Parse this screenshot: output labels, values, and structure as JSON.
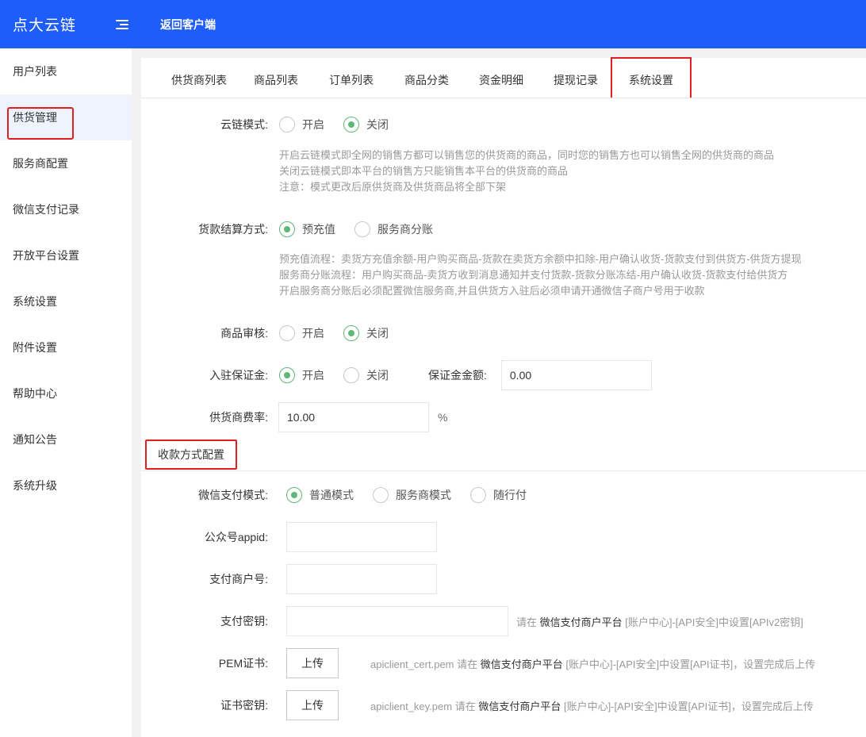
{
  "header": {
    "logo": "点大云链",
    "back_link": "返回客户端"
  },
  "sidebar": {
    "items": [
      {
        "label": "用户列表"
      },
      {
        "label": "供货管理"
      },
      {
        "label": "服务商配置"
      },
      {
        "label": "微信支付记录"
      },
      {
        "label": "开放平台设置"
      },
      {
        "label": "系统设置"
      },
      {
        "label": "附件设置"
      },
      {
        "label": "帮助中心"
      },
      {
        "label": "通知公告"
      },
      {
        "label": "系统升级"
      }
    ],
    "active": "供货管理"
  },
  "tabs": [
    {
      "label": "供货商列表"
    },
    {
      "label": "商品列表"
    },
    {
      "label": "订单列表"
    },
    {
      "label": "商品分类"
    },
    {
      "label": "资金明细"
    },
    {
      "label": "提现记录"
    },
    {
      "label": "系统设置"
    }
  ],
  "active_tab": "系统设置",
  "form": {
    "cloud_mode": {
      "label": "云链模式:",
      "options": [
        "开启",
        "关闭"
      ],
      "selected": "关闭",
      "help": [
        "开启云链模式即全网的销售方都可以销售您的供货商的商品，同时您的销售方也可以销售全网的供货商的商品",
        "关闭云链模式即本平台的销售方只能销售本平台的供货商的商品",
        "注意：模式更改后原供货商及供货商品将全部下架"
      ]
    },
    "settlement": {
      "label": "货款结算方式:",
      "options": [
        "预充值",
        "服务商分账"
      ],
      "selected": "预充值",
      "help": [
        "预充值流程：卖货方充值余额-用户购买商品-货款在卖货方余额中扣除-用户确认收货-货款支付到供货方-供货方提现",
        "服务商分账流程：用户购买商品-卖货方收到消息通知并支付货款-货款分账冻结-用户确认收货-货款支付给供货方",
        "开启服务商分账后必须配置微信服务商,并且供货方入驻后必须申请开通微信子商户号用于收款"
      ]
    },
    "goods_review": {
      "label": "商品审核:",
      "options": [
        "开启",
        "关闭"
      ],
      "selected": "关闭"
    },
    "deposit": {
      "label": "入驻保证金:",
      "options": [
        "开启",
        "关闭"
      ],
      "selected": "开启",
      "amount_label": "保证金金额:",
      "amount_value": "0.00"
    },
    "fee_rate": {
      "label": "供货商费率:",
      "value": "10.00",
      "unit": "%"
    }
  },
  "payment_section": {
    "title": "收款方式配置",
    "wechat_mode": {
      "label": "微信支付模式:",
      "options": [
        "普通模式",
        "服务商模式",
        "随行付"
      ],
      "selected": "普通模式"
    },
    "appid": {
      "label": "公众号appid:",
      "value": ""
    },
    "merchant_id": {
      "label": "支付商户号:",
      "value": ""
    },
    "pay_key": {
      "label": "支付密钥:",
      "value": "",
      "tip_prefix": "请在 ",
      "tip_platform": "微信支付商户平台",
      "tip_suffix": " [账户中心]-[API安全]中设置[APIv2密钥]"
    },
    "pem_cert": {
      "label": "PEM证书:",
      "button": "上传",
      "tip_prefix": "apiclient_cert.pem 请在 ",
      "tip_platform": "微信支付商户平台",
      "tip_suffix": " [账户中心]-[API安全]中设置[API证书]，设置完成后上传"
    },
    "cert_key": {
      "label": "证书密钥:",
      "button": "上传",
      "tip_prefix": "apiclient_key.pem 请在 ",
      "tip_platform": "微信支付商户平台",
      "tip_suffix": " [账户中心]-[API安全]中设置[API证书]，设置完成后上传"
    }
  },
  "colors": {
    "header_bg": "#1f5dfb",
    "radio_checked": "#5fb878",
    "highlight_box": "#e02020",
    "sidebar_active_bg": "#eef3fd"
  },
  "icons": {
    "menu_toggle": "menu-fold-icon"
  }
}
